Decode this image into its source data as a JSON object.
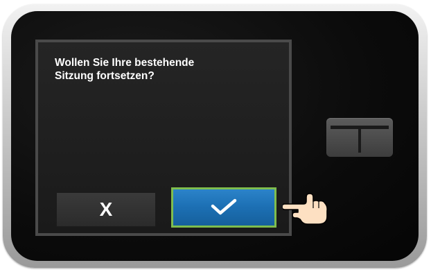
{
  "dialog": {
    "prompt": "Wollen Sie Ihre bestehende\nSitzung fortsetzen?",
    "cancel_symbol": "X",
    "confirm_icon": "check-icon"
  },
  "device": {
    "hardware_button_icon": "t-logo-icon"
  },
  "colors": {
    "confirm_button": "#1c6fb3",
    "confirm_highlight": "#7fbd4e",
    "cancel_button": "#2f2f2f",
    "screen_background": "#1f1f1f",
    "text": "#ffffff"
  }
}
